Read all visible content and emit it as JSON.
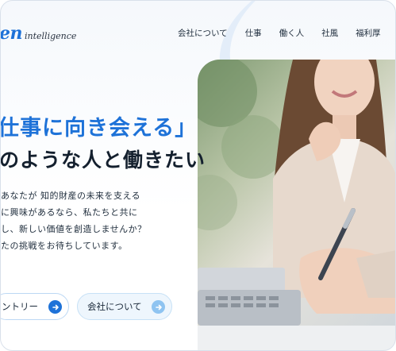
{
  "brand": {
    "mark": "en",
    "sub": "intelligence"
  },
  "nav": {
    "items": [
      "会社について",
      "仕事",
      "働く人",
      "社風",
      "福利厚"
    ]
  },
  "hero": {
    "headline_line1": "仕事に向き会える」",
    "headline_line2": "のような人と働きたい",
    "body_lines": [
      "あなたが 知的財産の未来を支える",
      "に興味があるなら、私たちと共に",
      "し、新しい価値を創造しませんか？",
      "たの挑戦をお待ちしています。"
    ]
  },
  "buttons": {
    "entry": "ントリー",
    "about": "会社について"
  },
  "colors": {
    "accent": "#1e72d8",
    "accent_light": "#8fc4f1",
    "text": "#14202e"
  },
  "icons": {
    "arrow": "arrow-right-circle-icon",
    "photo": "businesswoman-photo"
  }
}
